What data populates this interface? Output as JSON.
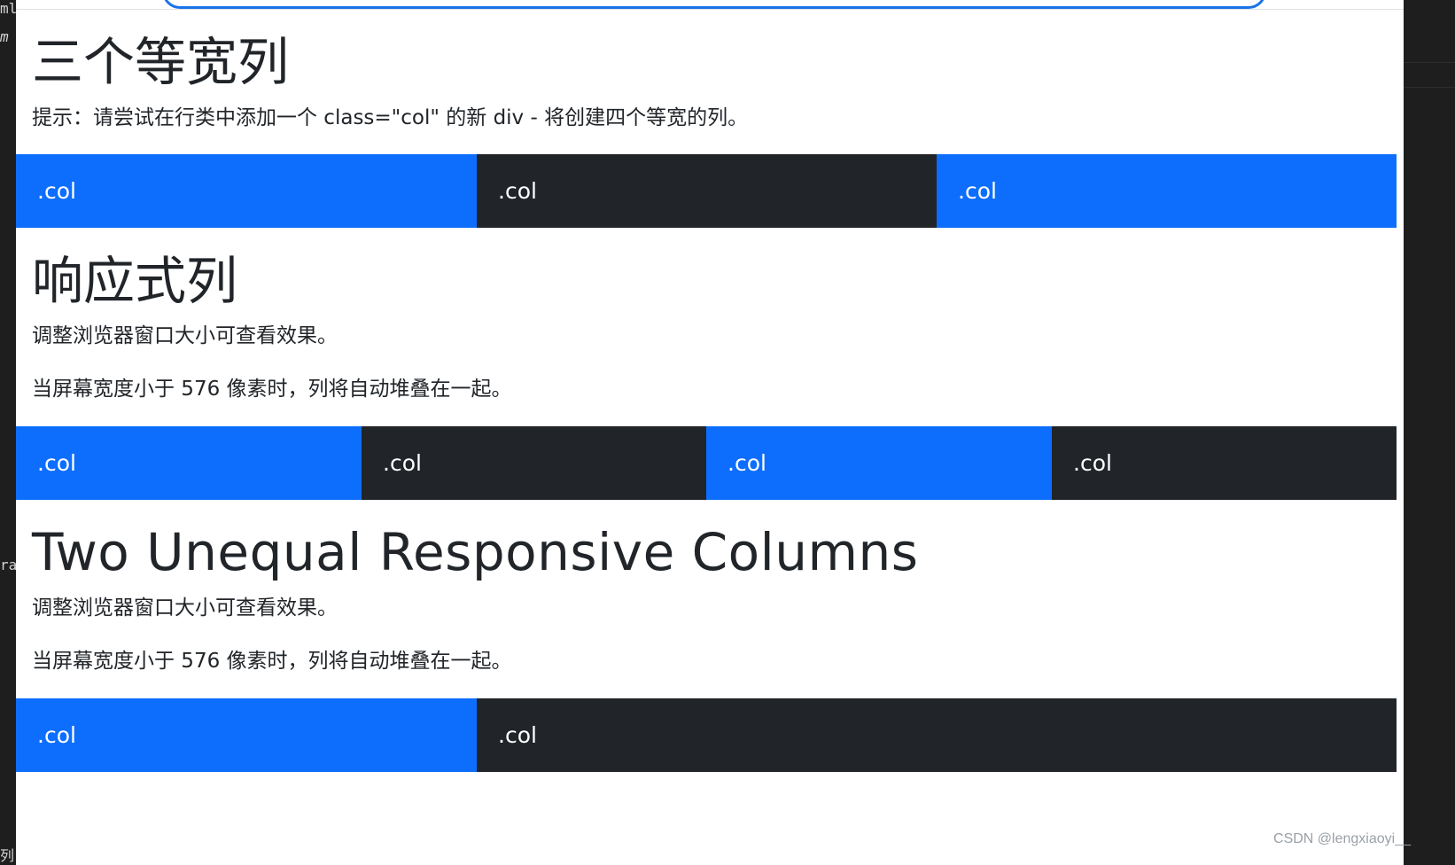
{
  "editor_fragments": [
    "ml",
    "m",
    "ra",
    "列"
  ],
  "section1": {
    "title": "三个等宽列",
    "tip": "提示：请尝试在行类中添加一个 class=\"col\" 的新 div - 将创建四个等宽的列。",
    "cols": [
      ".col",
      ".col",
      ".col"
    ]
  },
  "section2": {
    "title": "响应式列",
    "p1": "调整浏览器窗口大小可查看效果。",
    "p2": "当屏幕宽度小于 576 像素时，列将自动堆叠在一起。",
    "cols": [
      ".col",
      ".col",
      ".col",
      ".col"
    ]
  },
  "section3": {
    "title": "Two Unequal Responsive Columns",
    "p1": "调整浏览器窗口大小可查看效果。",
    "p2": "当屏幕宽度小于 576 像素时，列将自动堆叠在一起。",
    "cols": [
      ".col",
      ".col"
    ]
  },
  "watermark": "CSDN @lengxiaoyi__",
  "colors": {
    "primary": "#0d6efd",
    "dark": "#212529",
    "text": "#212529"
  }
}
